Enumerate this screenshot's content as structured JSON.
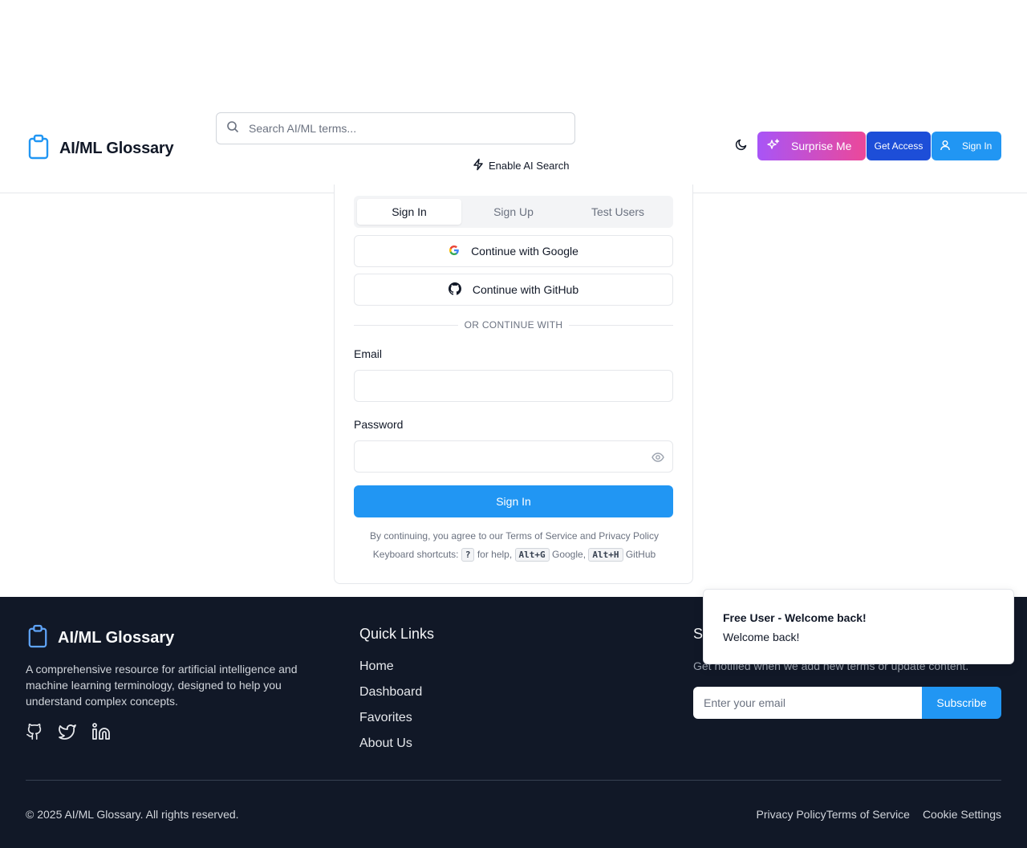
{
  "header": {
    "brand": "AI/ML Glossary",
    "search_placeholder": "Search AI/ML terms...",
    "ai_search_label": "Enable AI Search",
    "surprise_label": "Surprise Me",
    "get_access_label": "Get Access",
    "sign_in_label": "Sign In"
  },
  "auth": {
    "tabs": [
      "Sign In",
      "Sign Up",
      "Test Users"
    ],
    "active_tab": "Sign In",
    "google_label": "Continue with Google",
    "github_label": "Continue with GitHub",
    "divider_text": "OR CONTINUE WITH",
    "email_label": "Email",
    "email_value": "",
    "password_label": "Password",
    "password_value": "",
    "submit_label": "Sign In",
    "terms_text": "By continuing, you agree to our Terms of Service and Privacy Policy",
    "shortcuts": {
      "prefix": "Keyboard shortcuts:",
      "help_key": "?",
      "help_text": "for help,",
      "google_key": "Alt+G",
      "google_text": "Google,",
      "github_key": "Alt+H",
      "github_text": "GitHub"
    }
  },
  "footer": {
    "brand": "AI/ML Glossary",
    "description": "A comprehensive resource for artificial intelligence and machine learning terminology, designed to help you understand complex concepts.",
    "socials": [
      "github-icon",
      "twitter-icon",
      "linkedin-icon"
    ],
    "quick_links_title": "Quick Links",
    "quick_links": [
      "Home",
      "Dashboard",
      "Favorites",
      "About Us"
    ],
    "newsletter_title": "S",
    "newsletter_desc": "Get notified when we add new terms or update content.",
    "newsletter_placeholder": "Enter your email",
    "subscribe_label": "Subscribe",
    "copyright": "© 2025 AI/ML Glossary. All rights reserved.",
    "legal_links": [
      "Privacy Policy",
      "Terms of Service",
      "Cookie Settings"
    ]
  },
  "toast": {
    "title": "Free User - Welcome back!",
    "message": "Welcome back!"
  },
  "colors": {
    "primary": "#2196f3",
    "access": "#1d4ed8",
    "surprise_start": "#a855f7",
    "surprise_end": "#ec4899",
    "footer_bg": "#111827"
  }
}
